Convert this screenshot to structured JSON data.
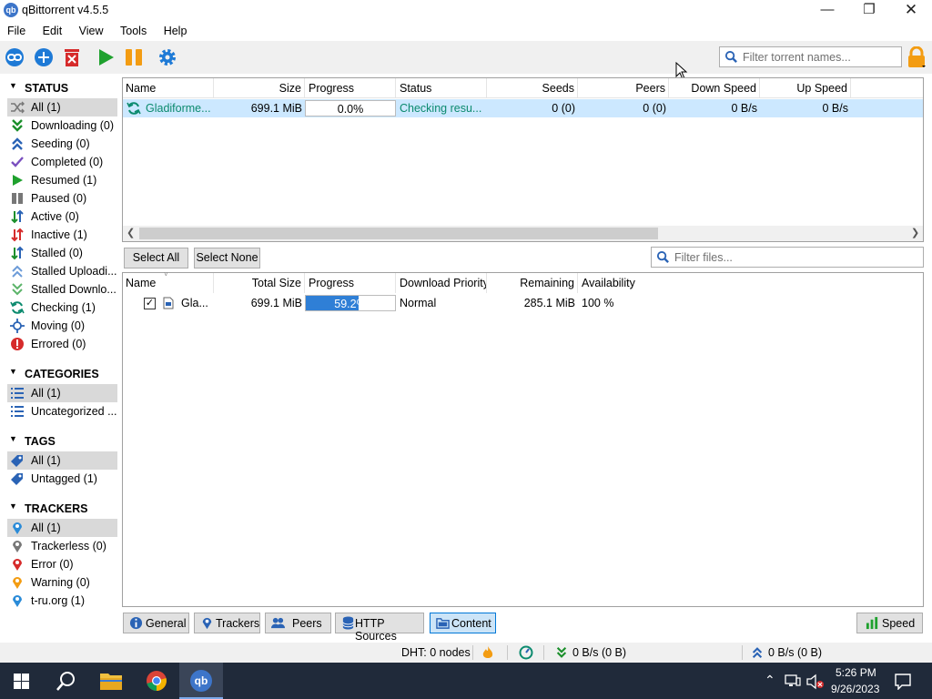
{
  "window": {
    "title": "qBittorrent v4.5.5",
    "app_icon_text": "qb"
  },
  "menu": [
    "File",
    "Edit",
    "View",
    "Tools",
    "Help"
  ],
  "toolbar": {
    "buttons": [
      "add-link",
      "add-torrent",
      "delete",
      "resume",
      "pause",
      "options"
    ],
    "filter_placeholder": "Filter torrent names..."
  },
  "sidebar": {
    "status": {
      "title": "STATUS",
      "items": [
        {
          "label": "All (1)",
          "icon": "shuffle-icon",
          "selected": true
        },
        {
          "label": "Downloading (0)",
          "icon": "download-icon"
        },
        {
          "label": "Seeding (0)",
          "icon": "upload-icon"
        },
        {
          "label": "Completed (0)",
          "icon": "check-icon"
        },
        {
          "label": "Resumed (1)",
          "icon": "play-icon"
        },
        {
          "label": "Paused (0)",
          "icon": "pause-icon"
        },
        {
          "label": "Active (0)",
          "icon": "active-arrows-icon"
        },
        {
          "label": "Inactive (1)",
          "icon": "inactive-arrows-icon"
        },
        {
          "label": "Stalled (0)",
          "icon": "stalled-arrows-icon"
        },
        {
          "label": "Stalled Uploadi...",
          "icon": "stalled-upload-icon"
        },
        {
          "label": "Stalled Downlo...",
          "icon": "stalled-download-icon"
        },
        {
          "label": "Checking (1)",
          "icon": "checking-icon"
        },
        {
          "label": "Moving (0)",
          "icon": "moving-icon"
        },
        {
          "label": "Errored (0)",
          "icon": "error-icon"
        }
      ]
    },
    "categories": {
      "title": "CATEGORIES",
      "items": [
        {
          "label": "All (1)",
          "selected": true
        },
        {
          "label": "Uncategorized ..."
        }
      ]
    },
    "tags": {
      "title": "TAGS",
      "items": [
        {
          "label": "All (1)",
          "selected": true
        },
        {
          "label": "Untagged (1)"
        }
      ]
    },
    "trackers": {
      "title": "TRACKERS",
      "items": [
        {
          "label": "All (1)",
          "selected": true
        },
        {
          "label": "Trackerless (0)"
        },
        {
          "label": "Error (0)"
        },
        {
          "label": "Warning (0)"
        },
        {
          "label": "t-ru.org (1)"
        }
      ]
    }
  },
  "torrents": {
    "columns": [
      "Name",
      "Size",
      "Progress",
      "Status",
      "Seeds",
      "Peers",
      "Down Speed",
      "Up Speed"
    ],
    "rows": [
      {
        "name": "Gladiforme...",
        "size": "699.1 MiB",
        "progress": "0.0%",
        "progress_fraction": 0.0,
        "status": "Checking resu...",
        "seeds": "0 (0)",
        "peers": "0 (0)",
        "down_speed": "0 B/s",
        "up_speed": "0 B/s"
      }
    ]
  },
  "files": {
    "select_all": "Select All",
    "select_none": "Select None",
    "filter_placeholder": "Filter files...",
    "columns": [
      "Name",
      "Total Size",
      "Progress",
      "Download Priority",
      "Remaining",
      "Availability"
    ],
    "rows": [
      {
        "name": "Gla...",
        "checked": true,
        "total_size": "699.1 MiB",
        "progress": "59.2%",
        "progress_fraction": 0.592,
        "priority": "Normal",
        "remaining": "285.1 MiB",
        "availability": "100 %"
      }
    ]
  },
  "tabs": [
    "General",
    "Trackers",
    "Peers",
    "HTTP Sources",
    "Content"
  ],
  "active_tab": "Content",
  "speed_button": "Speed",
  "statusbar": {
    "dht": "DHT: 0 nodes",
    "download": "0 B/s (0 B)",
    "upload": "0 B/s (0 B)"
  },
  "taskbar": {
    "time": "5:26 PM",
    "date": "9/26/2023",
    "apps": [
      "windows-start",
      "search",
      "file-explorer",
      "chrome",
      "qbittorrent"
    ]
  },
  "colors": {
    "accent": "#0078d7",
    "selection": "#cce8ff",
    "progress": "#2f7fd6",
    "checking_text": "#0b8a6e",
    "taskbar": "#202a3a"
  }
}
